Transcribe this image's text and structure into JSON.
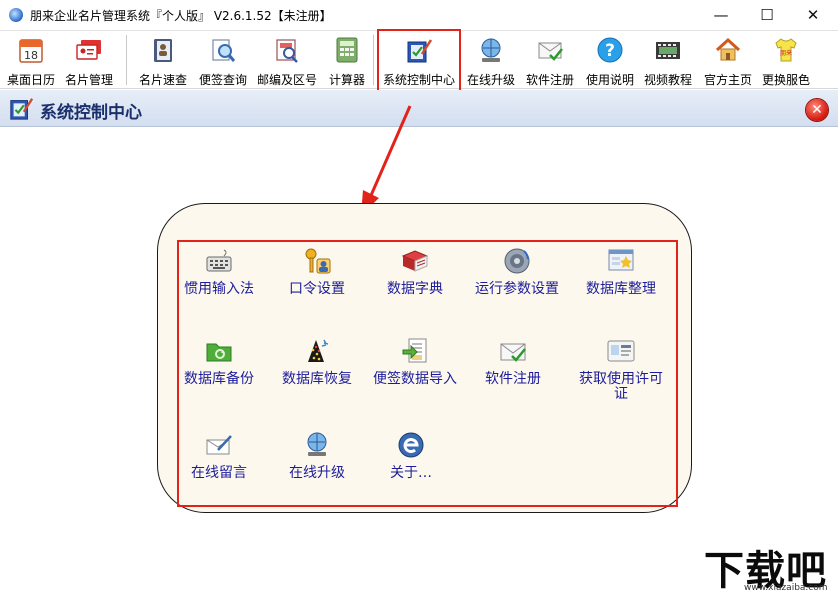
{
  "window": {
    "title": "朋来企业名片管理系统『个人版』 V2.6.1.52【未注册】",
    "minimize": "—",
    "maximize": "☐",
    "close": "✕"
  },
  "toolbar": {
    "buttons": [
      {
        "label": "桌面日历",
        "icon": "calendar-icon"
      },
      {
        "label": "名片管理",
        "icon": "business-cards-icon"
      },
      {
        "label": "名片速查",
        "icon": "contact-book-icon"
      },
      {
        "label": "便签查询",
        "icon": "magnifier-note-icon"
      },
      {
        "label": "邮编及区号",
        "icon": "postal-code-icon"
      },
      {
        "label": "计算器",
        "icon": "calculator-icon"
      },
      {
        "label": "系统控制中心",
        "icon": "control-center-icon"
      },
      {
        "label": "在线升级",
        "icon": "globe-upgrade-icon"
      },
      {
        "label": "软件注册",
        "icon": "register-envelope-icon"
      },
      {
        "label": "使用说明",
        "icon": "help-icon"
      },
      {
        "label": "视频教程",
        "icon": "film-icon"
      },
      {
        "label": "官方主页",
        "icon": "home-icon"
      },
      {
        "label": "更换服色",
        "icon": "shirt-icon"
      }
    ]
  },
  "panel": {
    "title": "系统控制中心",
    "close": "✕"
  },
  "control_center": {
    "items": [
      {
        "label": "惯用输入法",
        "icon": "keyboard-icon"
      },
      {
        "label": "口令设置",
        "icon": "keys-user-icon"
      },
      {
        "label": "数据字典",
        "icon": "dictionary-book-icon"
      },
      {
        "label": "运行参数设置",
        "icon": "gear-disc-icon"
      },
      {
        "label": "数据库整理",
        "icon": "database-tidy-icon"
      },
      {
        "label": "数据库备份",
        "icon": "folder-backup-icon"
      },
      {
        "label": "数据库恢复",
        "icon": "restore-sparkle-icon"
      },
      {
        "label": "便签数据导入",
        "icon": "import-document-icon"
      },
      {
        "label": "软件注册",
        "icon": "register-envelope-icon"
      },
      {
        "label": "获取使用许可证",
        "icon": "license-card-icon"
      },
      {
        "label": "在线留言",
        "icon": "message-pen-icon"
      },
      {
        "label": "在线升级",
        "icon": "globe-upgrade-icon"
      },
      {
        "label": "关于…",
        "icon": "about-e-icon"
      }
    ]
  },
  "watermark": {
    "text": "下载吧",
    "sub": "www.xiazaiba.com"
  },
  "colors": {
    "highlight": "#e2231a",
    "link_text": "#1d1d9a",
    "panel_bg": "#fcf8ee"
  }
}
